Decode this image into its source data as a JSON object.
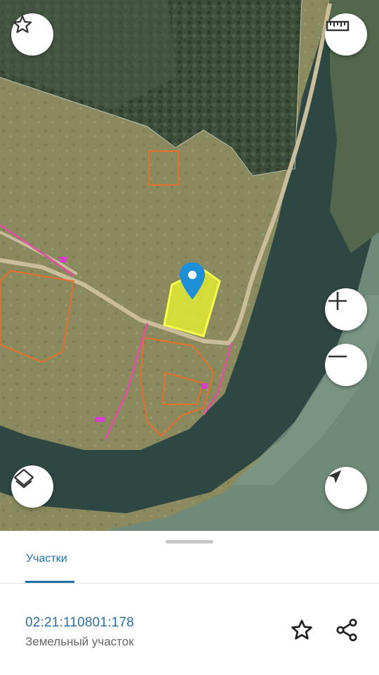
{
  "map": {
    "buttons": {
      "favorite_icon": "star-outline",
      "ruler_icon": "ruler",
      "zoom_in_icon": "plus",
      "zoom_out_icon": "minus",
      "layers_icon": "layers",
      "locate_icon": "navigation-arrow"
    },
    "selected_parcel_color": "#e6f030",
    "boundary_color": "#e86e2a",
    "pin_color": "#1f8fd6"
  },
  "sheet": {
    "tabs": [
      {
        "label": "Участки",
        "active": true
      }
    ],
    "parcel": {
      "cadastral_number": "02:21:110801:178",
      "type": "Земельный участок"
    },
    "actions": {
      "favorite_icon": "star-outline",
      "share_icon": "share"
    },
    "accent_color": "#1f6fa8"
  }
}
